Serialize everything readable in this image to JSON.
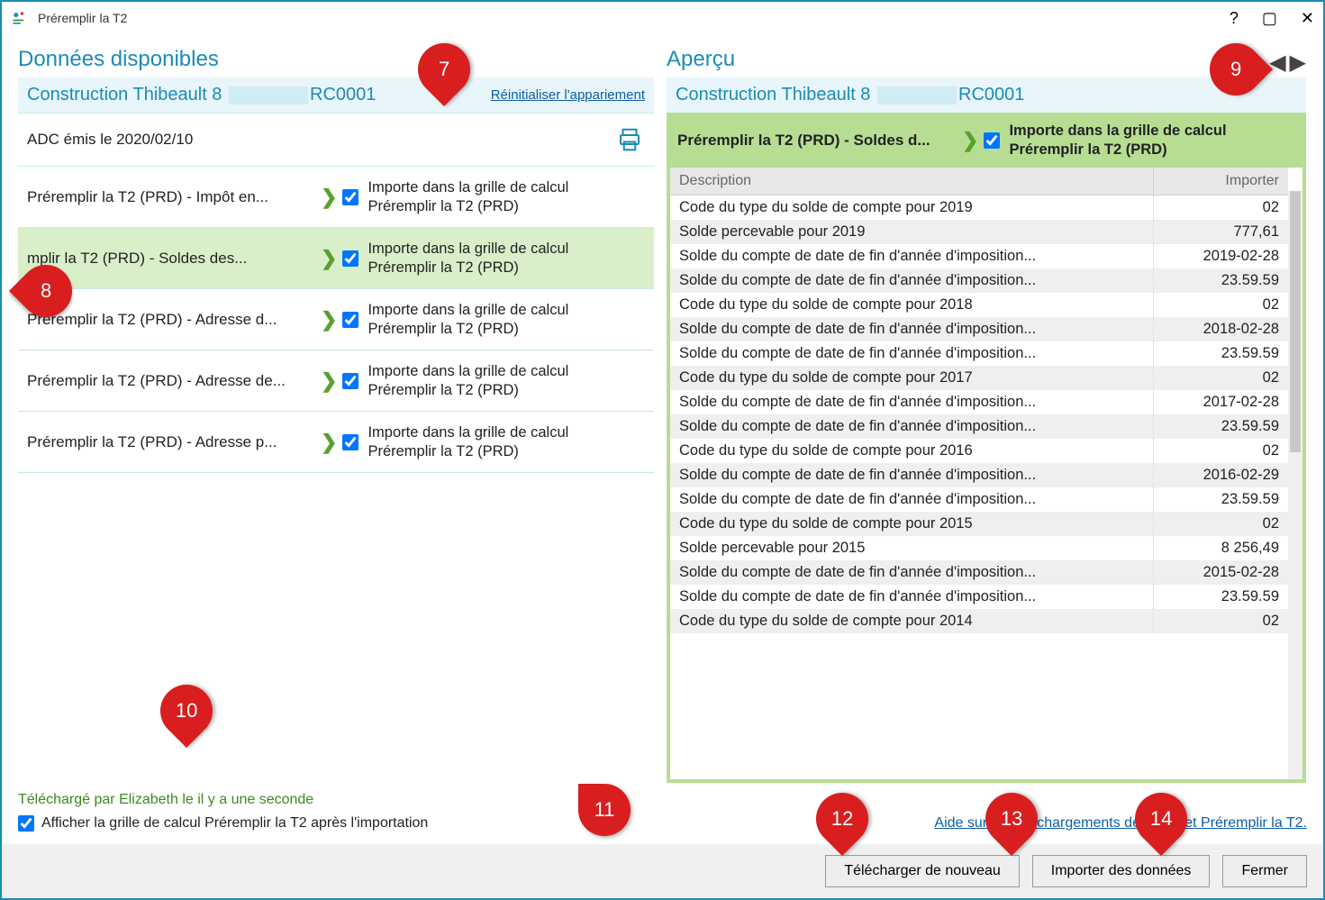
{
  "window": {
    "title": "Préremplir la T2"
  },
  "left": {
    "heading": "Données disponibles",
    "company_prefix": "Construction Thibeault 8",
    "company_suffix": "RC0001",
    "reset_link": "Réinitialiser l'appariement",
    "adc_row": "ADC émis le 2020/02/10",
    "import_line1": "Importe dans la grille de calcul",
    "import_line2": "Préremplir la T2 (PRD)",
    "rows": [
      {
        "label": "Préremplir la T2 (PRD) - Impôt en..."
      },
      {
        "label": "Préremplir la T2 (PRD) - Soldes des...",
        "selected": true,
        "truncated": "mplir la T2 (PRD) - Soldes des..."
      },
      {
        "label": "Préremplir la T2 (PRD) - Adresse d..."
      },
      {
        "label": "Préremplir la T2 (PRD) - Adresse de..."
      },
      {
        "label": "Préremplir la T2 (PRD) - Adresse p..."
      }
    ]
  },
  "right": {
    "heading": "Aperçu",
    "company_prefix": "Construction Thibeault 8",
    "company_suffix": "RC0001",
    "target_label": "Préremplir la T2 (PRD) - Soldes d...",
    "target_import1": "Importe dans la grille de calcul",
    "target_import2": "Préremplir la T2 (PRD)",
    "col_desc": "Description",
    "col_import": "Importer",
    "rows": [
      {
        "d": "Code du type du solde de compte pour 2019",
        "v": "02"
      },
      {
        "d": "Solde percevable pour 2019",
        "v": "777,61"
      },
      {
        "d": "Solde du compte de date de fin d'année d'imposition...",
        "v": "2019-02-28"
      },
      {
        "d": "Solde du compte de date de fin d'année d'imposition...",
        "v": "23.59.59"
      },
      {
        "d": "Code du type du solde de compte pour 2018",
        "v": "02"
      },
      {
        "d": "Solde du compte de date de fin d'année d'imposition...",
        "v": "2018-02-28"
      },
      {
        "d": "Solde du compte de date de fin d'année d'imposition...",
        "v": "23.59.59"
      },
      {
        "d": "Code du type du solde de compte pour 2017",
        "v": "02"
      },
      {
        "d": "Solde du compte de date de fin d'année d'imposition...",
        "v": "2017-02-28"
      },
      {
        "d": "Solde du compte de date de fin d'année d'imposition...",
        "v": "23.59.59"
      },
      {
        "d": "Code du type du solde de compte pour 2016",
        "v": "02"
      },
      {
        "d": "Solde du compte de date de fin d'année d'imposition...",
        "v": "2016-02-29"
      },
      {
        "d": "Solde du compte de date de fin d'année d'imposition...",
        "v": "23.59.59"
      },
      {
        "d": "Code du type du solde de compte pour 2015",
        "v": "02"
      },
      {
        "d": "Solde percevable pour 2015",
        "v": "8 256,49"
      },
      {
        "d": "Solde du compte de date de fin d'année d'imposition...",
        "v": "2015-02-28"
      },
      {
        "d": "Solde du compte de date de fin d'année d'imposition...",
        "v": "23.59.59"
      },
      {
        "d": "Code du type du solde de compte pour 2014",
        "v": "02"
      }
    ]
  },
  "footer": {
    "download_status": "Téléchargé par Elizabeth le il y a une seconde",
    "help_link": "Aide sur les téléchargements de l'ARC et Préremplir la T2.",
    "show_grid": "Afficher la grille de calcul Préremplir la T2 après l'importation",
    "btn_download": "Télécharger de nouveau",
    "btn_import": "Importer des données",
    "btn_close": "Fermer"
  },
  "callouts": {
    "c7": "7",
    "c8": "8",
    "c9": "9",
    "c10": "10",
    "c11": "11",
    "c12": "12",
    "c13": "13",
    "c14": "14"
  }
}
